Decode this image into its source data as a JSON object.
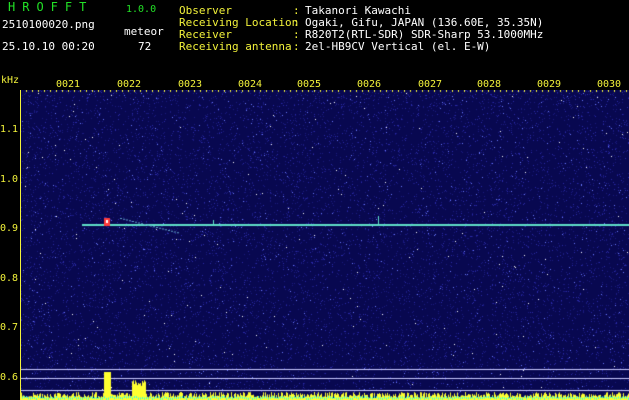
{
  "header": {
    "logo": "HROFFT",
    "version": "1.0.0",
    "filename": "2510100020.png",
    "datetime": "25.10.10 00:20",
    "meteor_label": "meteor",
    "meteor_count": "72",
    "info": [
      {
        "label": "Observer",
        "value": "Takanori Kawachi"
      },
      {
        "label": "Receiving Location",
        "value": "Ogaki, Gifu, JAPAN (136.60E, 35.35N)"
      },
      {
        "label": "Receiver",
        "value": "R820T2(RTL-SDR) SDR-Sharp 53.1000MHz"
      },
      {
        "label": "Receiving antenna",
        "value": "2el-HB9CV Vertical (el. E-W)"
      }
    ]
  },
  "axis": {
    "unit": "kHz",
    "time_ticks": [
      "0021",
      "0022",
      "0023",
      "0024",
      "0025",
      "0026",
      "0027",
      "0028",
      "0029",
      "0030"
    ],
    "freq_ticks": [
      "1.1",
      "1.0",
      "0.9",
      "0.8",
      "0.7",
      "0.6"
    ]
  },
  "colors": {
    "background": "#0a0a5a",
    "carrier": "#5fe0c8",
    "echo": "#ff3a3a",
    "text_green": "#22e026",
    "text_yellow": "#f2f23a"
  }
}
